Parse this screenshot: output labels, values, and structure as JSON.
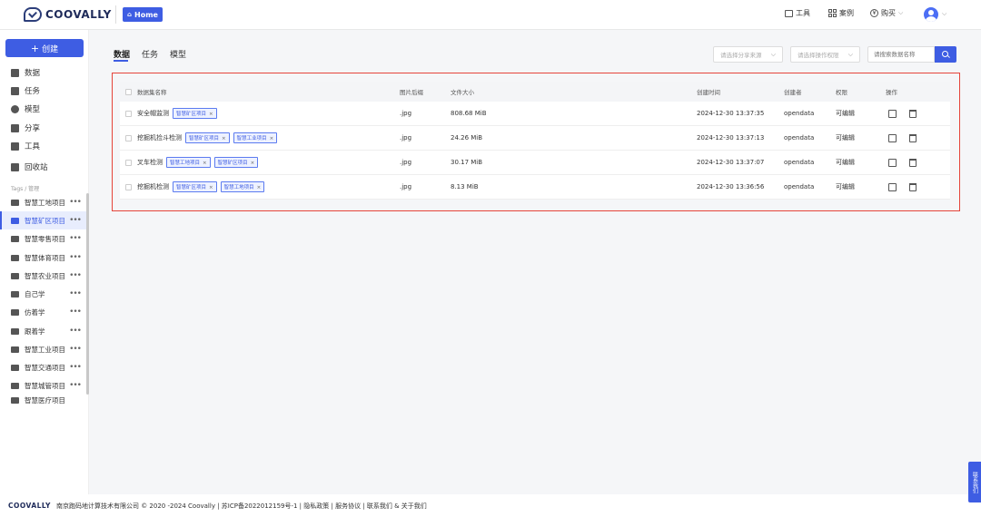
{
  "header": {
    "logo_text": "COOVALLY",
    "home_label": "Home",
    "nav": {
      "tools": "工具",
      "cases": "案例",
      "buy": "购买"
    }
  },
  "sidebar": {
    "create_label": "创建",
    "items": [
      {
        "label": "数据",
        "icon": "data-icon"
      },
      {
        "label": "任务",
        "icon": "task-icon"
      },
      {
        "label": "模型",
        "icon": "model-icon"
      },
      {
        "label": "分享",
        "icon": "share-icon"
      },
      {
        "label": "工具",
        "icon": "tool-icon"
      },
      {
        "label": "回收站",
        "icon": "trash-icon"
      }
    ],
    "tags_label": "Tags / 管理",
    "tags": [
      {
        "label": "智慧工地项目",
        "active": false
      },
      {
        "label": "智慧矿区项目",
        "active": true
      },
      {
        "label": "智慧零售项目",
        "active": false
      },
      {
        "label": "智慧体育项目",
        "active": false
      },
      {
        "label": "智慧农业项目",
        "active": false
      },
      {
        "label": "自己学",
        "active": false
      },
      {
        "label": "仿着学",
        "active": false
      },
      {
        "label": "跟着学",
        "active": false
      },
      {
        "label": "智慧工业项目",
        "active": false
      },
      {
        "label": "智慧交通项目",
        "active": false
      },
      {
        "label": "智慧城管项目",
        "active": false
      },
      {
        "label": "智慧医疗项目",
        "active": false
      }
    ]
  },
  "main": {
    "tabs": [
      "数据",
      "任务",
      "模型"
    ],
    "filters": {
      "share_source_placeholder": "请选择分享来源",
      "permission_placeholder": "请选择操作权限",
      "search_placeholder": "请搜索数据名称"
    },
    "table": {
      "columns": [
        "数据集名称",
        "图片后缀",
        "文件大小",
        "创建时间",
        "创建者",
        "权限",
        "操作"
      ],
      "rows": [
        {
          "name": "安全帽监测",
          "tags": [
            "智慧矿区项目"
          ],
          "suffix": ".jpg",
          "size": "808.68 MiB",
          "created": "2024-12-30 13:37:35",
          "creator": "opendata",
          "permission": "可编辑"
        },
        {
          "name": "挖掘机捡斗检测",
          "tags": [
            "智慧矿区项目",
            "智慧工业项目"
          ],
          "suffix": ".jpg",
          "size": "24.26 MiB",
          "created": "2024-12-30 13:37:13",
          "creator": "opendata",
          "permission": "可编辑"
        },
        {
          "name": "叉车检测",
          "tags": [
            "智慧工地项目",
            "智慧矿区项目"
          ],
          "suffix": ".jpg",
          "size": "30.17 MiB",
          "created": "2024-12-30 13:37:07",
          "creator": "opendata",
          "permission": "可编辑"
        },
        {
          "name": "挖掘机检测",
          "tags": [
            "智慧矿区项目",
            "智慧工地项目"
          ],
          "suffix": ".jpg",
          "size": "8.13 MiB",
          "created": "2024-12-30 13:36:56",
          "creator": "opendata",
          "permission": "可编辑"
        }
      ]
    }
  },
  "footer": {
    "logo": "COOVALLY",
    "text": "南京跑码地计算技术有限公司 © 2020 -2024 Coovally | 苏ICP备2022012159号-1 | 隐私政策 | 服务协议 | 联系我们 & 关于我们"
  },
  "contact_label": "联系我们",
  "colors": {
    "accent": "#3e5de3",
    "highlight_border": "#e5443a"
  }
}
